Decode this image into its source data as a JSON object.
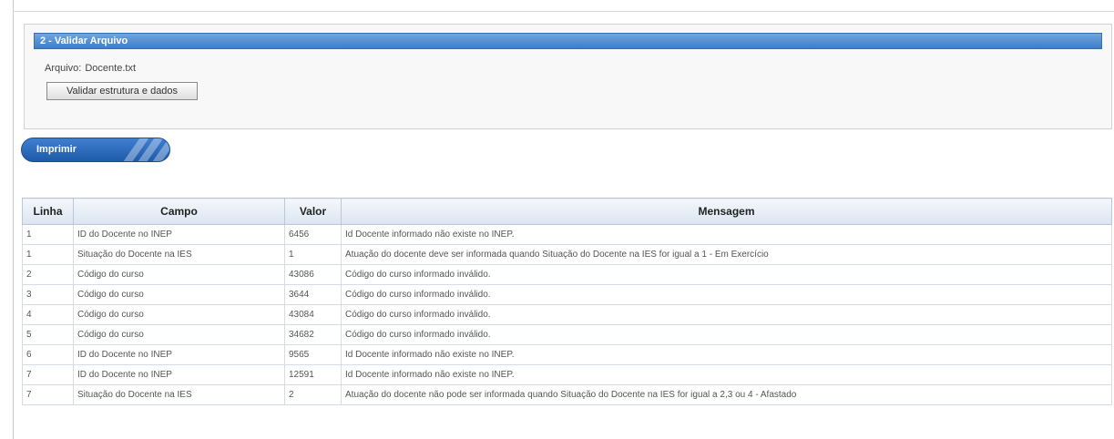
{
  "validate_section": {
    "header": "2 - Validar Arquivo",
    "file_label": "Arquivo:",
    "file_name": "Docente.txt",
    "validate_button": "Validar estrutura e dados"
  },
  "print_button": "Imprimir",
  "table": {
    "headers": [
      "Linha",
      "Campo",
      "Valor",
      "Mensagem"
    ],
    "rows": [
      {
        "linha": "1",
        "campo": "ID do Docente no INEP",
        "valor": "6456",
        "mensagem": "Id Docente informado não existe no INEP."
      },
      {
        "linha": "1",
        "campo": "Situação do Docente na IES",
        "valor": "1",
        "mensagem": "Atuação do docente deve ser informada quando Situação do Docente na IES for igual a 1 - Em Exercício"
      },
      {
        "linha": "2",
        "campo": "Código do curso",
        "valor": "43086",
        "mensagem": "Código do curso informado inválido."
      },
      {
        "linha": "3",
        "campo": "Código do curso",
        "valor": "3644",
        "mensagem": "Código do curso informado inválido."
      },
      {
        "linha": "4",
        "campo": "Código do curso",
        "valor": "43084",
        "mensagem": "Código do curso informado inválido."
      },
      {
        "linha": "5",
        "campo": "Código do curso",
        "valor": "34682",
        "mensagem": "Código do curso informado inválido."
      },
      {
        "linha": "6",
        "campo": "ID do Docente no INEP",
        "valor": "9565",
        "mensagem": "Id Docente informado não existe no INEP."
      },
      {
        "linha": "7",
        "campo": "ID do Docente no INEP",
        "valor": "12591",
        "mensagem": "Id Docente informado não existe no INEP."
      },
      {
        "linha": "7",
        "campo": "Situação do Docente na IES",
        "valor": "2",
        "mensagem": "Atuação do docente não pode ser informada quando Situação do Docente na IES for igual a 2,3 ou 4 - Afastado"
      }
    ]
  }
}
